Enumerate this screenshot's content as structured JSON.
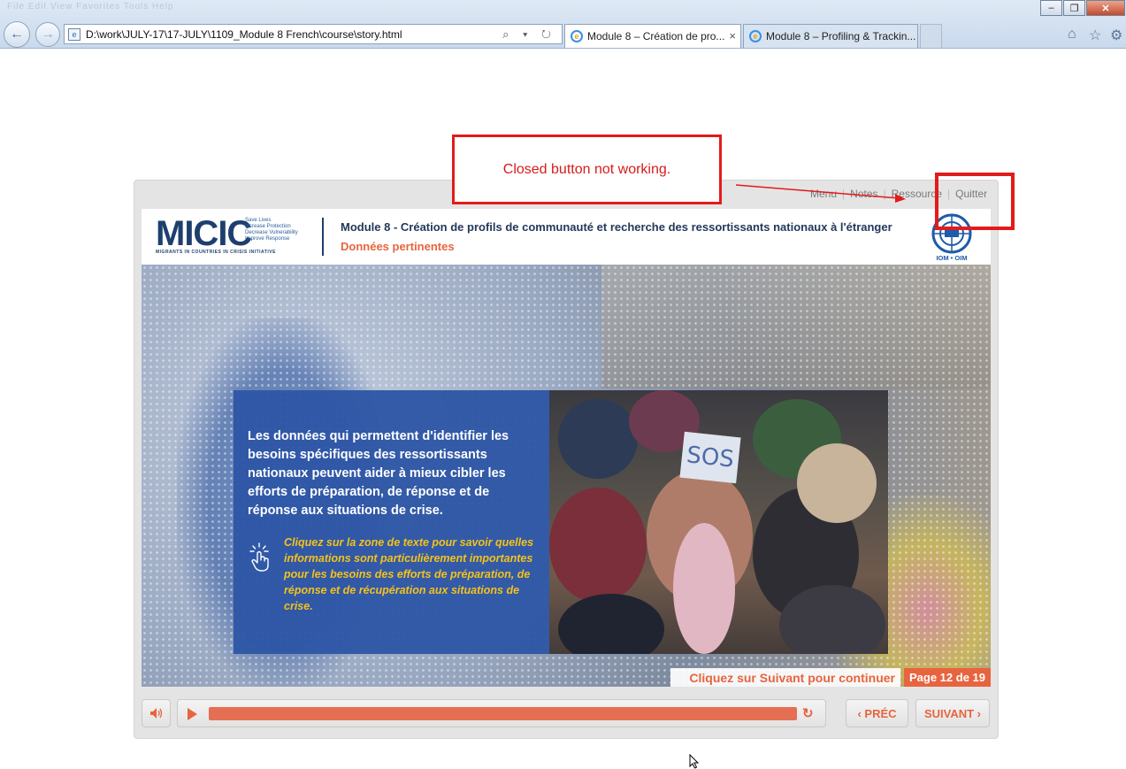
{
  "browser": {
    "menu_ghost": "File  Edit  View  Favorites  Tools  Help",
    "address": "D:\\work\\JULY-17\\17-JULY\\1109_Module 8 French\\course\\story.html",
    "address_tools": "⌕ ▾ ↻",
    "tabs": [
      {
        "label": "Module 8 – Création de pro...",
        "active": true
      },
      {
        "label": "Module 8 – Profiling & Trackin...",
        "active": false
      }
    ],
    "tab_close": "×",
    "window": {
      "min": "–",
      "max": "❐",
      "close": "✕"
    },
    "toolbar_icons": {
      "home": "⌂",
      "favorites": "☆",
      "tools": "⚙"
    }
  },
  "annotation": {
    "text": "Closed button not working.",
    "color": "#e31b1b"
  },
  "player": {
    "top_links": [
      "Menu",
      "Notes",
      "Ressource",
      "Quitter"
    ],
    "header": {
      "logo": "MICIC",
      "logo_tagline": "Save Lives\nIncrease Protection\nDecrease Vulnerability\nImprove Response",
      "logo_subtitle": "MIGRANTS IN COUNTRIES IN CRISIS INITIATIVE",
      "module_title": "Module 8 - Création de profils de communauté et recherche des ressortissants nationaux à l'étranger",
      "section_title": "Données pertinentes",
      "partner_logo_label": "IOM • OIM"
    },
    "card": {
      "main_text": "Les données qui permettent d'identifier les besoins spécifiques des ressortissants nationaux peuvent aider à mieux cibler les efforts de préparation, de réponse et de réponse aux situations de crise.",
      "hint_text": "Cliquez sur la zone de texte pour savoir quelles informations sont particulièrement importantes pour les besoins des efforts de préparation, de réponse et de récupération aux situations de crise."
    },
    "photo_sign": "SOS",
    "continue_text": "Cliquez sur Suivant pour continuer",
    "page_indicator": "Page 12 de 19",
    "controls": {
      "prev": "‹ PRÉC",
      "next": "SUIVANT ›",
      "progress": 1.0
    },
    "accent_color": "#e8643e",
    "card_color": "#2e56a5"
  }
}
